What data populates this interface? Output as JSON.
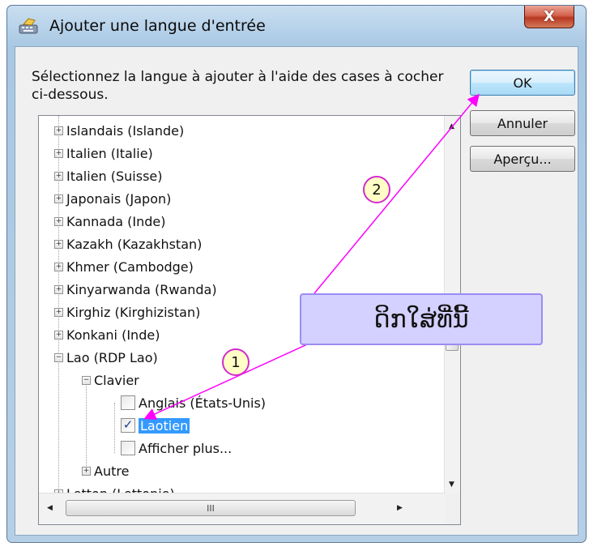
{
  "window": {
    "title": "Ajouter une langue d'entrée",
    "close_glyph": "X"
  },
  "instruction": "Sélectionnez la langue à ajouter à l'aide des cases à cocher ci-dessous.",
  "buttons": {
    "ok": "OK",
    "cancel": "Annuler",
    "preview": "Aperçu..."
  },
  "tree": {
    "languages": [
      "Islandais (Islande)",
      "Italien (Italie)",
      "Italien (Suisse)",
      "Japonais (Japon)",
      "Kannada (Inde)",
      "Kazakh (Kazakhstan)",
      "Khmer (Cambodge)",
      "Kinyarwanda (Rwanda)",
      "Kirghiz (Kirghizistan)",
      "Konkani (Inde)"
    ],
    "expanded_language": "Lao (RDP Lao)",
    "keyboard_group": "Clavier",
    "keyboards": [
      {
        "label": "Anglais (États-Unis)",
        "checked": false,
        "selected": false
      },
      {
        "label": "Laotien",
        "checked": true,
        "selected": true
      },
      {
        "label": "Afficher plus...",
        "checked": false,
        "selected": false
      }
    ],
    "other_group": "Autre",
    "after_language": "Letton (Lettonie)",
    "scroll_thumb_grip": "III"
  },
  "annotations": {
    "callout_text": "ດິກໃສ່ທີ່ນີ້",
    "step1": "1",
    "step2": "2",
    "color": "#ff00ff"
  }
}
